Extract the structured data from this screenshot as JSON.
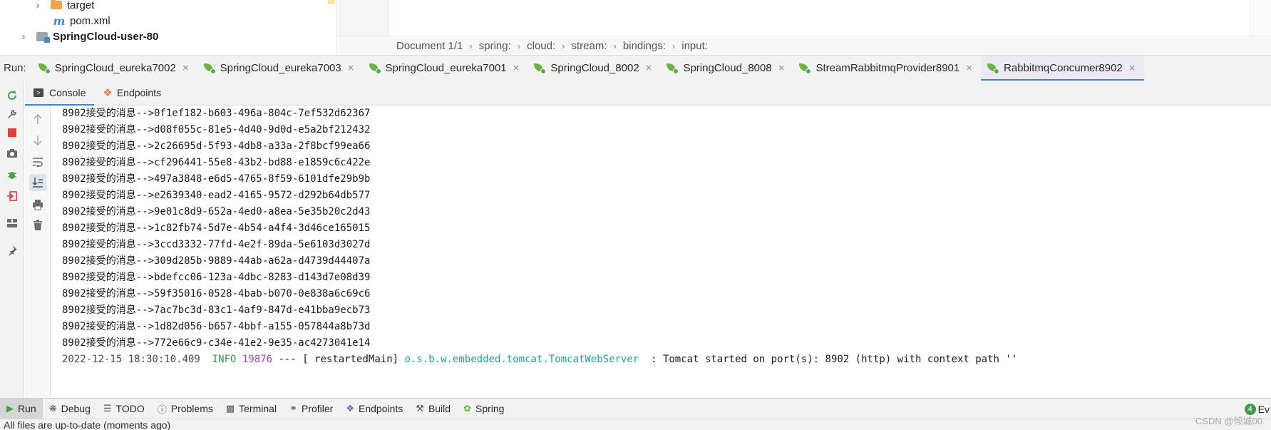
{
  "project_tree": {
    "items": [
      {
        "label": "target",
        "icon": "folder-icon"
      },
      {
        "label": "pom.xml",
        "icon": "maven-icon"
      },
      {
        "label": "SpringCloud-user-80",
        "icon": "module-folder-icon"
      }
    ]
  },
  "breadcrumb": [
    "Document 1/1",
    "spring:",
    "cloud:",
    "stream:",
    "bindings:",
    "input:"
  ],
  "run_bar": {
    "label": "Run:",
    "tabs": [
      {
        "label": "SpringCloud_eureka7002"
      },
      {
        "label": "SpringCloud_eureka7003"
      },
      {
        "label": "SpringCloud_eureka7001"
      },
      {
        "label": "SpringCloud_8002"
      },
      {
        "label": "SpringCloud_8008"
      },
      {
        "label": "StreamRabbitmqProvider8901"
      },
      {
        "label": "RabbitmqConcumer8902",
        "active": true
      }
    ],
    "close_glyph": "×"
  },
  "sub_tabs": {
    "console": "Console",
    "endpoints": "Endpoints"
  },
  "console": {
    "lines": [
      "8902接受的消息-->0f1ef182-b603-496a-804c-7ef532d62367",
      "8902接受的消息-->d08f055c-81e5-4d40-9d0d-e5a2bf212432",
      "8902接受的消息-->2c26695d-5f93-4db8-a33a-2f8bcf99ea66",
      "8902接受的消息-->cf296441-55e8-43b2-bd88-e1859c6c422e",
      "8902接受的消息-->497a3848-e6d5-4765-8f59-6101dfe29b9b",
      "8902接受的消息-->e2639340-ead2-4165-9572-d292b64db577",
      "8902接受的消息-->9e01c8d9-652a-4ed0-a8ea-5e35b20c2d43",
      "8902接受的消息-->1c82fb74-5d7e-4b54-a4f4-3d46ce165015",
      "8902接受的消息-->3ccd3332-77fd-4e2f-89da-5e6103d3027d",
      "8902接受的消息-->309d285b-9889-44ab-a62a-d4739d44407a",
      "8902接受的消息-->bdefcc06-123a-4dbc-8283-d143d7e08d39",
      "8902接受的消息-->59f35016-0528-4bab-b070-0e838a6c69c6",
      "8902接受的消息-->7ac7bc3d-83c1-4af9-847d-e41bba9ecb73",
      "8902接受的消息-->1d82d056-b657-4bbf-a155-057844a8b73d",
      "8902接受的消息-->772e66c9-c34e-41e2-9e35-ac4273041e14"
    ],
    "log_line": {
      "date": "2022-12-15 18:30:10.409",
      "level": "INFO",
      "pid": "19876",
      "sep": "--- [  restartedMain]",
      "logger": "o.s.b.w.embedded.tomcat.TomcatWebServer",
      "message": ": Tomcat started on port(s): 8902 (http) with context path ''"
    }
  },
  "bottom_tools": {
    "items": [
      {
        "label": "Run",
        "icon": "run-icon",
        "active": true
      },
      {
        "label": "Debug",
        "icon": "debug-icon"
      },
      {
        "label": "TODO",
        "icon": "todo-icon"
      },
      {
        "label": "Problems",
        "icon": "problems-icon"
      },
      {
        "label": "Terminal",
        "icon": "terminal-icon"
      },
      {
        "label": "Profiler",
        "icon": "profiler-icon"
      },
      {
        "label": "Endpoints",
        "icon": "endpoints-icon"
      },
      {
        "label": "Build",
        "icon": "build-icon"
      },
      {
        "label": "Spring",
        "icon": "spring-icon"
      }
    ],
    "event_log": {
      "badge": "4",
      "label": "Ev"
    }
  },
  "status_bar": {
    "text": "All files are up-to-date (moments ago)"
  },
  "watermark": "CSDN @倾城00",
  "colors": {
    "accent": "#4083c9",
    "spring_green": "#6db33f",
    "log_info": "#3e8f4c",
    "log_pid": "#9b47a8",
    "log_class": "#1f9c9c",
    "stop_red": "#e0403a"
  }
}
